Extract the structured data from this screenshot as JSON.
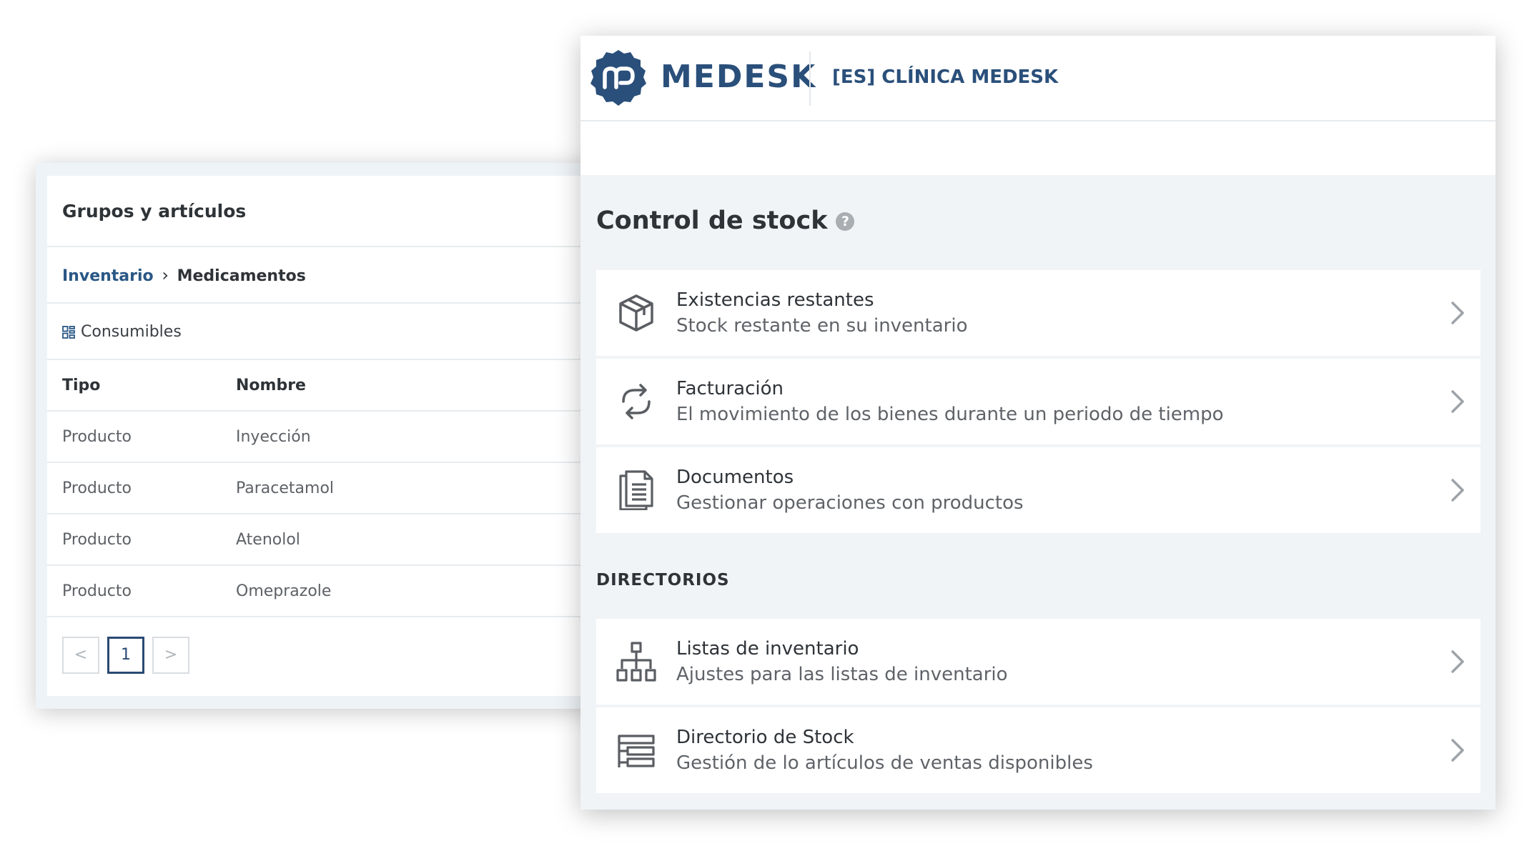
{
  "left_panel": {
    "title": "Grupos y artículos",
    "breadcrumb": {
      "link": "Inventario",
      "separator": "›",
      "current": "Medicamentos"
    },
    "group": {
      "icon": "grid-icon",
      "label": "Consumibles"
    },
    "table": {
      "headers": {
        "tipo": "Tipo",
        "nombre": "Nombre"
      },
      "rows": [
        {
          "tipo": "Producto",
          "nombre": "Inyección"
        },
        {
          "tipo": "Producto",
          "nombre": "Paracetamol"
        },
        {
          "tipo": "Producto",
          "nombre": "Atenolol"
        },
        {
          "tipo": "Producto",
          "nombre": "Omeprazole"
        }
      ]
    },
    "pagination": {
      "prev": "<",
      "current_page": "1",
      "next": ">"
    }
  },
  "right_panel": {
    "brand": {
      "logo_icon": "medesk-logo-icon",
      "name": "MEDESK",
      "color": "#2a4f7a"
    },
    "clinic_name": "[ES] CLÍNICA MEDESK",
    "page_title": "Control de stock",
    "help_glyph": "?",
    "items": [
      {
        "icon": "box-icon",
        "title": "Existencias restantes",
        "description": "Stock restante en su inventario"
      },
      {
        "icon": "sync-icon",
        "title": "Facturación",
        "description": "El movimiento de los bienes durante un periodo de tiempo"
      },
      {
        "icon": "document-icon",
        "title": "Documentos",
        "description": "Gestionar operaciones con productos"
      }
    ],
    "section_label": "DIRECTORIOS",
    "directory_items": [
      {
        "icon": "hierarchy-icon",
        "title": "Listas de inventario",
        "description": "Ajustes para las listas de inventario"
      },
      {
        "icon": "list-tree-icon",
        "title": "Directorio de Stock",
        "description": "Gestión de lo artículos de ventas disponibles"
      }
    ]
  }
}
